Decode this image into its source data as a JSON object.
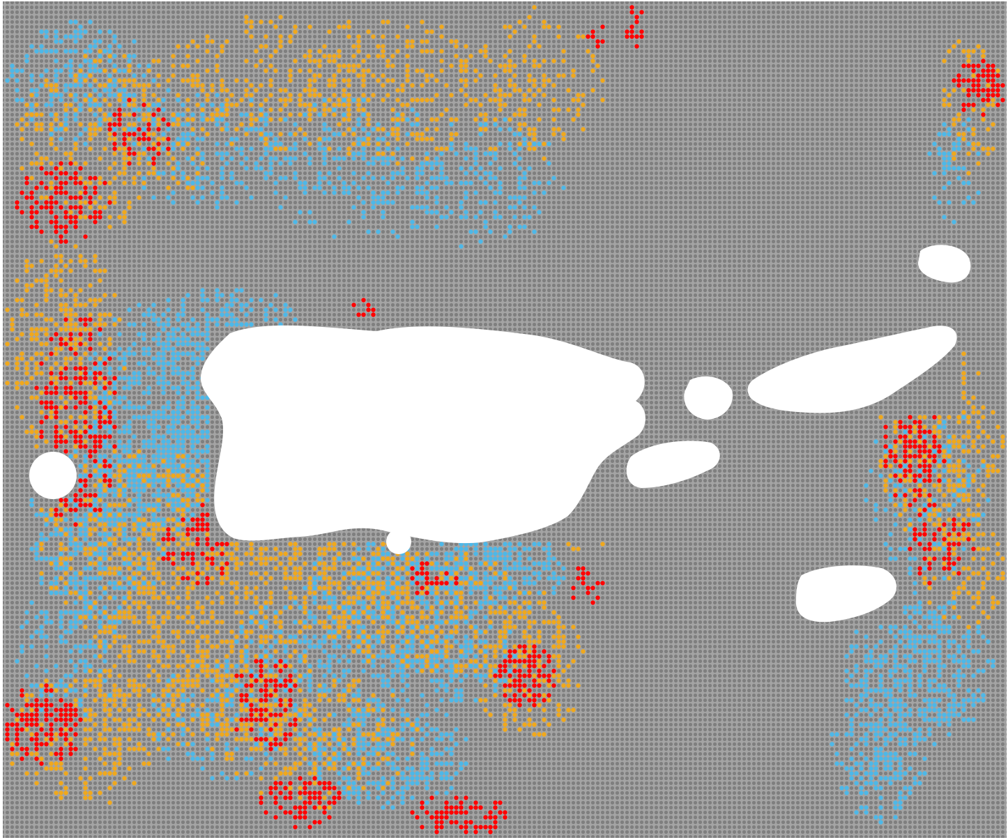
{
  "map": {
    "colors": {
      "background": "#ffffff",
      "grid": "#8c8c8c",
      "light_blue": "#4db8e8",
      "orange": "#f0a81c",
      "red": "#ff0000",
      "land": "#ffffff"
    },
    "legend_present": false,
    "title_present": false
  }
}
